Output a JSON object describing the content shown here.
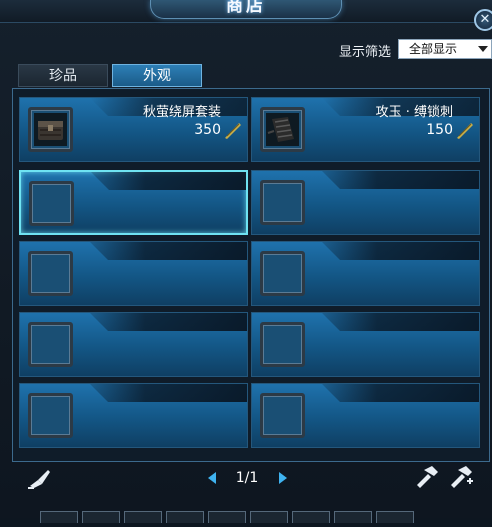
{
  "window": {
    "title": "商店",
    "close_icon": "close-icon"
  },
  "filter": {
    "label": "显示筛选",
    "selected": "全部显示"
  },
  "tabs": [
    {
      "label": "珍品",
      "active": false
    },
    {
      "label": "外观",
      "active": true
    }
  ],
  "items": [
    {
      "name": "秋萤绕屏套装",
      "price": "350",
      "icon": "outfit-chest-icon",
      "price_icon": "jade-currency-icon"
    },
    {
      "name": "攻玉 · 缚锁刺",
      "price": "150",
      "icon": "bracer-icon",
      "price_icon": "jade-currency-icon"
    }
  ],
  "pager": {
    "text": "1/1"
  },
  "colors": {
    "accent": "#3fb3f0",
    "selected_border": "#6fe3f2",
    "slot_blue": "#1f72ad"
  }
}
